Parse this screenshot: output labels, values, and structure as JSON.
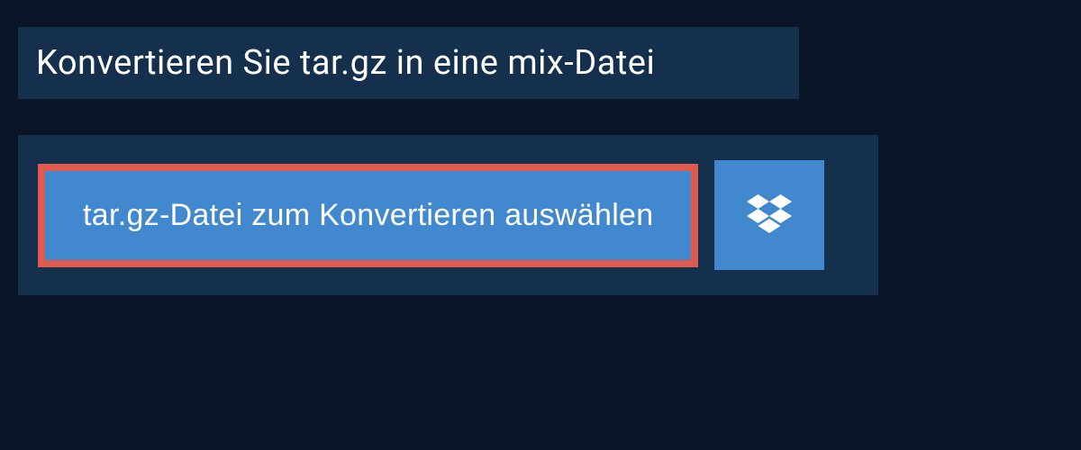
{
  "header": {
    "title": "Konvertieren Sie tar.gz in eine mix-Datei"
  },
  "upload": {
    "select_button_label": "tar.gz-Datei zum Konvertieren auswählen"
  },
  "colors": {
    "bg_dark": "#0a1628",
    "panel": "#14304d",
    "button": "#4188cf",
    "highlight_border": "#e05a50",
    "text": "#ffffff"
  }
}
